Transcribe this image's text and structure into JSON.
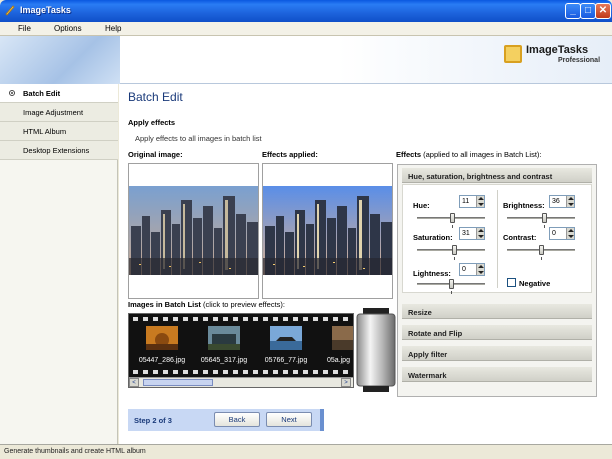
{
  "window": {
    "title": "ImageTasks"
  },
  "menu": [
    "File",
    "Options",
    "Help"
  ],
  "logo": {
    "main": "ImageTasks",
    "sub": "Professional"
  },
  "sidebar": {
    "items": [
      {
        "label": "Batch Edit",
        "active": true
      },
      {
        "label": "Image Adjustment"
      },
      {
        "label": "HTML Album"
      },
      {
        "label": "Desktop Extensions"
      }
    ]
  },
  "main": {
    "title": "Batch Edit",
    "section_title": "Apply effects",
    "section_desc": "Apply effects to all images in batch list",
    "original_label": "Original image:",
    "effects_applied_label": "Effects applied:",
    "batch_label": "Images in Batch List",
    "batch_note": "(click to preview effects):",
    "thumbnails": [
      "05447_286.jpg",
      "05645_317.jpg",
      "05766_77.jpg",
      "05a.jpg"
    ]
  },
  "effects": {
    "title": "Effects",
    "note": "(applied to all images in Batch List):",
    "sections": [
      "Hue, saturation, brightness and contrast",
      "Resize",
      "Rotate and Flip",
      "Apply filter",
      "Watermark"
    ],
    "controls": {
      "hue": {
        "label": "Hue:",
        "value": "11",
        "level": 0.52
      },
      "saturation": {
        "label": "Saturation:",
        "value": "31",
        "level": 0.55
      },
      "lightness": {
        "label": "Lightness:",
        "value": "0",
        "level": 0.5
      },
      "brightness": {
        "label": "Brightness:",
        "value": "36",
        "level": 0.56
      },
      "contrast": {
        "label": "Contrast:",
        "value": "0",
        "level": 0.5
      }
    },
    "negative_label": "Negative",
    "negative_checked": false
  },
  "wizard": {
    "step": "Step 2 of 3",
    "back": "Back",
    "next": "Next"
  },
  "status": "Generate thumbnails and create HTML album",
  "colors": {
    "title_bar": "#1d63dc",
    "accent": "#1a3a7a",
    "wizard_bar": "#c8d8f4"
  }
}
